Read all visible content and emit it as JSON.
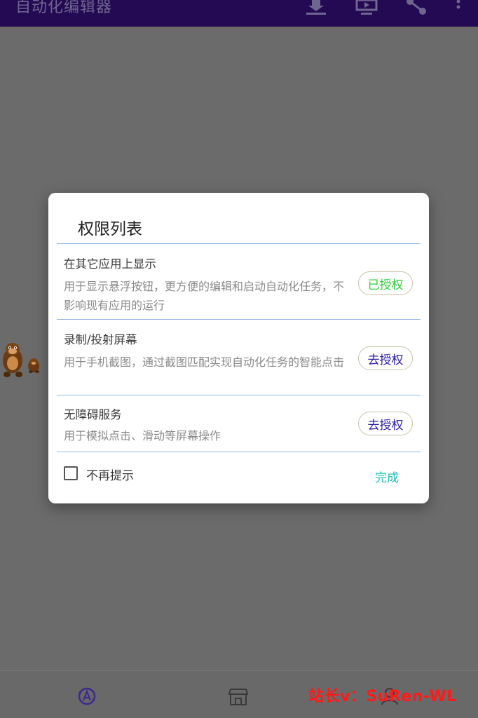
{
  "app_bar": {
    "title": "自动化编辑器",
    "bg_color": "#230a52",
    "icons": [
      "download-icon",
      "screen-cast-icon",
      "share-icon",
      "more-vert-icon"
    ]
  },
  "floating_widget": {
    "icon": "monkey-sprite-icon"
  },
  "dialog": {
    "title": "权限列表",
    "divider_color": "#8fb6e6",
    "permissions": [
      {
        "title": "在其它应用上显示",
        "description": "用于显示悬浮按钮，更方便的编辑和启动自动化任务，不影响现有应用的运行",
        "button_label": "已授权",
        "status": "granted",
        "button_color": "#2fcf3a"
      },
      {
        "title": "录制/投射屏幕",
        "description": "用于手机截图，通过截图匹配实现自动化任务的智能点击",
        "button_label": "去授权",
        "status": "pending",
        "button_color": "#2a1ea8"
      },
      {
        "title": "无障碍服务",
        "description": "用于模拟点击、滑动等屏幕操作",
        "button_label": "去授权",
        "status": "pending",
        "button_color": "#2a1ea8"
      }
    ],
    "dont_remind_label": "不再提示",
    "dont_remind_checked": false,
    "done_label": "完成",
    "done_color": "#20c2b8"
  },
  "bottom_nav": {
    "items": [
      {
        "icon": "automation-icon",
        "color": "#3d2a8c"
      },
      {
        "icon": "store-icon",
        "color": "#3a3a3a"
      },
      {
        "icon": "profile-icon",
        "color": "#3a3a3a"
      }
    ]
  },
  "watermark": {
    "text": "站长v：SuRen-WL",
    "color": "#ff1a1a"
  }
}
